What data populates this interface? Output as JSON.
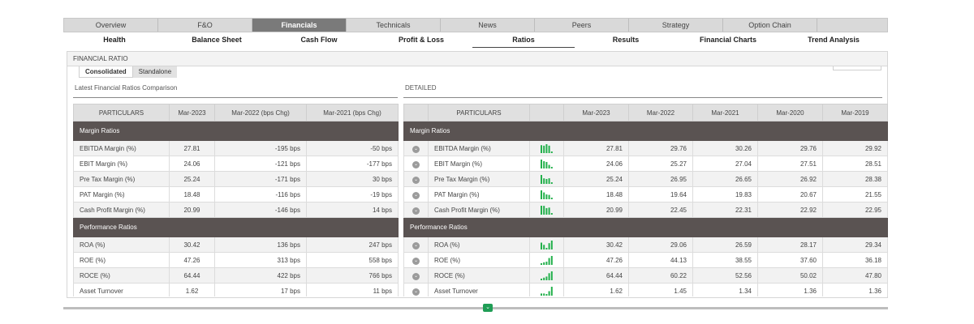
{
  "top_tabs": [
    {
      "label": "Overview",
      "active": false
    },
    {
      "label": "F&O",
      "active": false
    },
    {
      "label": "Financials",
      "active": true
    },
    {
      "label": "Technicals",
      "active": false
    },
    {
      "label": "News",
      "active": false
    },
    {
      "label": "Peers",
      "active": false
    },
    {
      "label": "Strategy",
      "active": false
    },
    {
      "label": "Option Chain",
      "active": false
    }
  ],
  "sub_tabs": [
    {
      "label": "Health",
      "active": false
    },
    {
      "label": "Balance Sheet",
      "active": false
    },
    {
      "label": "Cash Flow",
      "active": false
    },
    {
      "label": "Profit & Loss",
      "active": false
    },
    {
      "label": "Ratios",
      "active": true
    },
    {
      "label": "Results",
      "active": false
    },
    {
      "label": "Financial Charts",
      "active": false
    },
    {
      "label": "Trend Analysis",
      "active": false
    }
  ],
  "panel": {
    "header": "FINANCIAL RATIO",
    "view_tabs": [
      {
        "label": "Consolidated",
        "active": true
      },
      {
        "label": "Standalone",
        "active": false
      }
    ]
  },
  "left": {
    "title": "Latest Financial Ratios Comparison",
    "headers": [
      "PARTICULARS",
      "Mar-2023",
      "Mar-2022 (bps Chg)",
      "Mar-2021 (bps Chg)"
    ],
    "groups": [
      {
        "name": "Margin Ratios",
        "rows": [
          [
            "EBITDA Margin (%)",
            "27.81",
            "-195 bps",
            "-50 bps"
          ],
          [
            "EBIT Margin (%)",
            "24.06",
            "-121 bps",
            "-177 bps"
          ],
          [
            "Pre Tax Margin (%)",
            "25.24",
            "-171 bps",
            "30 bps"
          ],
          [
            "PAT Margin (%)",
            "18.48",
            "-116 bps",
            "-19 bps"
          ],
          [
            "Cash Profit Margin (%)",
            "20.99",
            "-146 bps",
            "14 bps"
          ]
        ]
      },
      {
        "name": "Performance Ratios",
        "rows": [
          [
            "ROA (%)",
            "30.42",
            "136 bps",
            "247 bps"
          ],
          [
            "ROE (%)",
            "47.26",
            "313 bps",
            "558 bps"
          ],
          [
            "ROCE (%)",
            "64.44",
            "422 bps",
            "766 bps"
          ],
          [
            "Asset Turnover",
            "1.62",
            "17 bps",
            "11 bps"
          ]
        ]
      }
    ]
  },
  "right": {
    "title": "DETAILED",
    "headers": [
      "",
      "PARTICULARS",
      "",
      "Mar-2023",
      "Mar-2022",
      "Mar-2021",
      "Mar-2020",
      "Mar-2019"
    ],
    "spark_color": "#22b04b",
    "groups": [
      {
        "name": "Margin Ratios",
        "rows": [
          {
            "label": "EBITDA Margin (%)",
            "values": [
              "27.81",
              "29.76",
              "30.26",
              "29.76",
              "29.92"
            ]
          },
          {
            "label": "EBIT Margin (%)",
            "values": [
              "24.06",
              "25.27",
              "27.04",
              "27.51",
              "28.51"
            ]
          },
          {
            "label": "Pre Tax Margin (%)",
            "values": [
              "25.24",
              "26.95",
              "26.65",
              "26.92",
              "28.38"
            ]
          },
          {
            "label": "PAT Margin (%)",
            "values": [
              "18.48",
              "19.64",
              "19.83",
              "20.67",
              "21.55"
            ]
          },
          {
            "label": "Cash Profit Margin (%)",
            "values": [
              "20.99",
              "22.45",
              "22.31",
              "22.92",
              "22.95"
            ]
          }
        ]
      },
      {
        "name": "Performance Ratios",
        "rows": [
          {
            "label": "ROA (%)",
            "values": [
              "30.42",
              "29.06",
              "26.59",
              "28.17",
              "29.34"
            ]
          },
          {
            "label": "ROE (%)",
            "values": [
              "47.26",
              "44.13",
              "38.55",
              "37.60",
              "36.18"
            ]
          },
          {
            "label": "ROCE (%)",
            "values": [
              "64.44",
              "60.22",
              "52.56",
              "50.02",
              "47.80"
            ]
          },
          {
            "label": "Asset Turnover",
            "values": [
              "1.62",
              "1.45",
              "1.34",
              "1.36",
              "1.36"
            ]
          }
        ]
      }
    ]
  }
}
